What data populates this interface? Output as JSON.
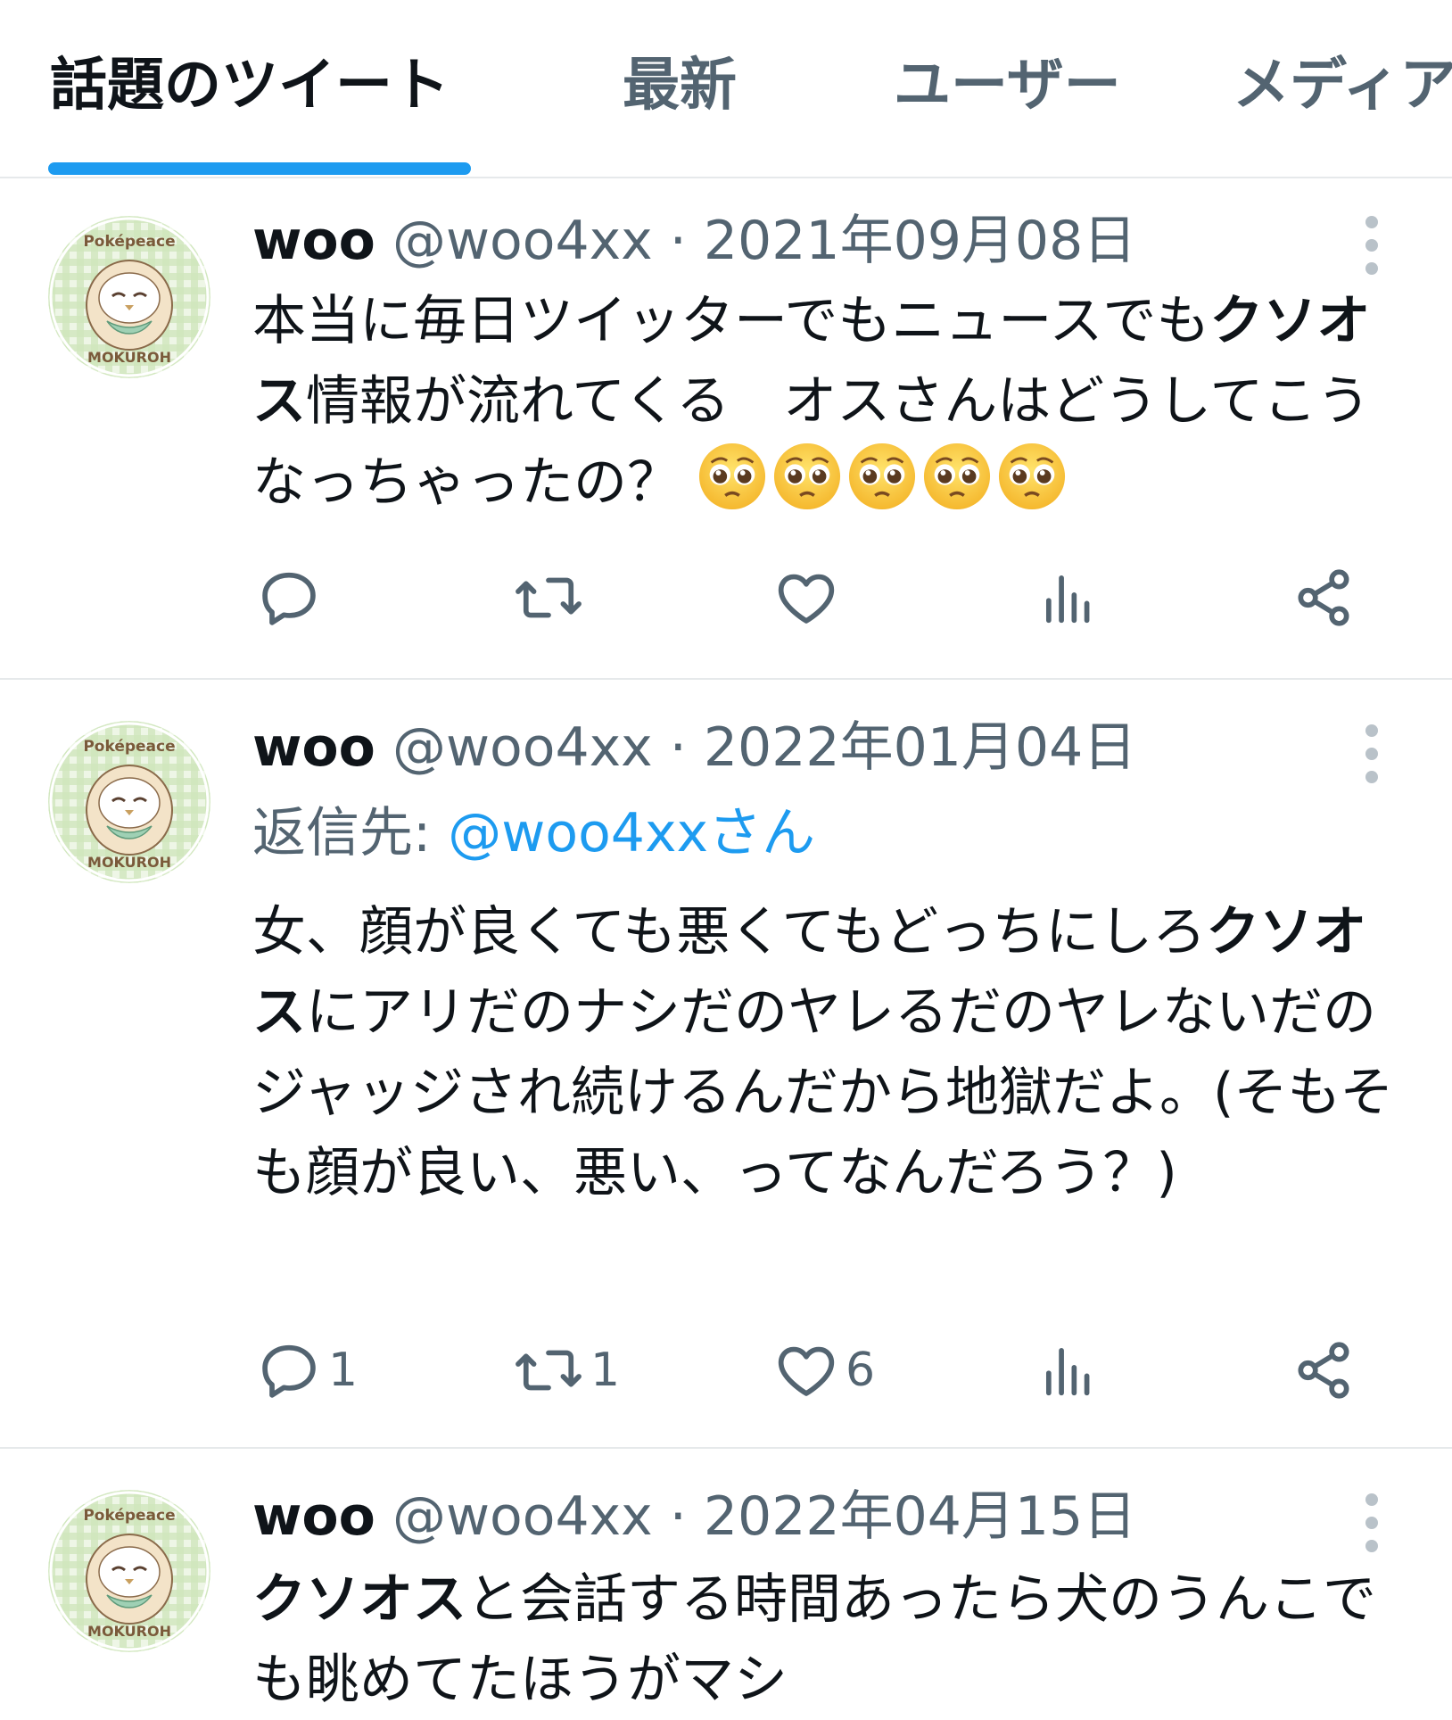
{
  "tabs": [
    {
      "label": "話題のツイート",
      "active": true
    },
    {
      "label": "最新",
      "active": false
    },
    {
      "label": "ユーザー",
      "active": false
    },
    {
      "label": "メディア",
      "active": false
    }
  ],
  "colors": {
    "accent": "#1d9bf0",
    "text_primary": "#0f1419",
    "text_secondary": "#536471",
    "divider": "#e6e9eb"
  },
  "tweets": [
    {
      "name": "woo",
      "handle": "@woo4xx",
      "separator": "·",
      "date": "2021年09月08日",
      "avatar_badge_top": "Poképeace",
      "avatar_badge_bottom": "MOKUROH",
      "text_before": "本当に毎日ツイッターでもニュースでも",
      "text_bold": "クソオス",
      "text_after": "情報が流れてくる　オスさんはどうしてこうなっちゃったの？",
      "emojis": [
        "pleading-face",
        "pleading-face",
        "pleading-face",
        "pleading-face",
        "pleading-face"
      ],
      "reply_count": "",
      "retweet_count": "",
      "like_count": ""
    },
    {
      "name": "woo",
      "handle": "@woo4xx",
      "separator": "·",
      "date": "2022年01月04日",
      "avatar_badge_top": "Poképeace",
      "avatar_badge_bottom": "MOKUROH",
      "reply_label": "返信先: ",
      "reply_mention": "@woo4xxさん",
      "text_before": "女、顔が良くても悪くてもどっちにしろ",
      "text_bold": "クソオス",
      "text_after": "にアリだのナシだのヤレるだのヤレないだのジャッジされ続けるんだから地獄だよ。(そもそも顔が良い、悪い、ってなんだろう？)",
      "reply_count": "1",
      "retweet_count": "1",
      "like_count": "6"
    },
    {
      "name": "woo",
      "handle": "@woo4xx",
      "separator": "·",
      "date": "2022年04月15日",
      "avatar_badge_top": "Poképeace",
      "avatar_badge_bottom": "MOKUROH",
      "text_before": "",
      "text_bold": "クソオス",
      "text_after": "と会話する時間あったら犬のうんこでも眺めてたほうがマシ"
    }
  ]
}
